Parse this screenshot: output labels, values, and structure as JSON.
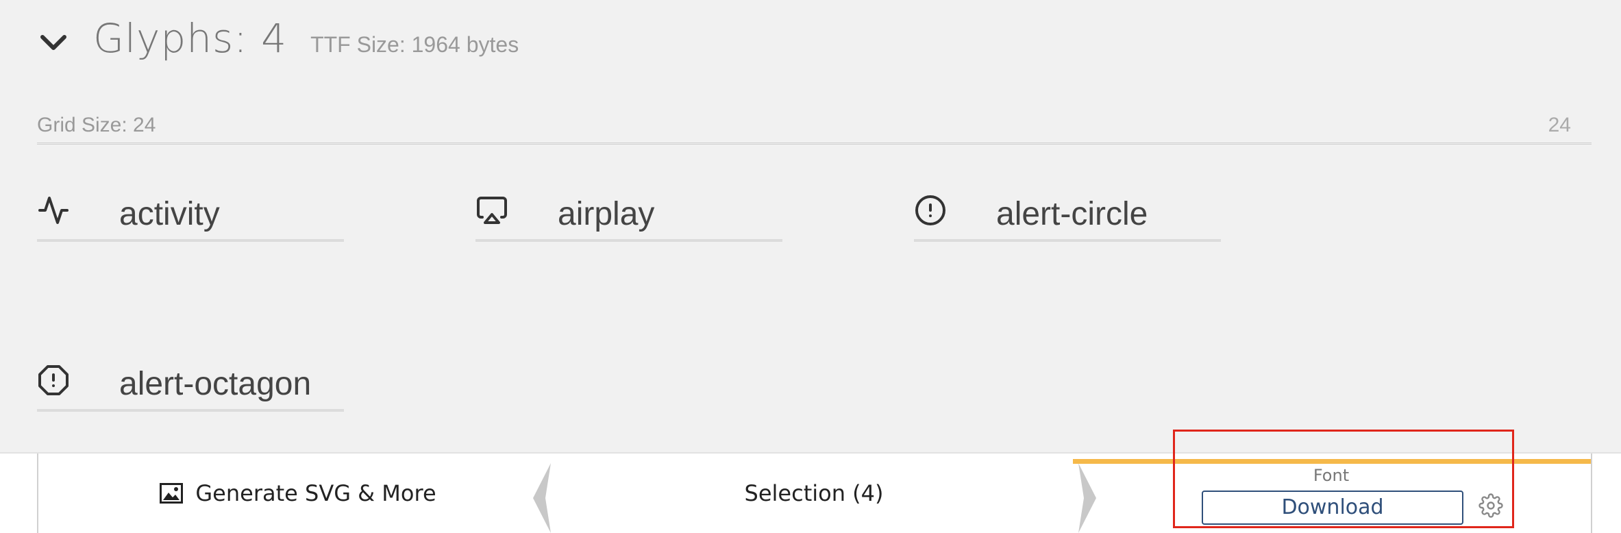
{
  "header": {
    "glyphs_title": "Glyphs: 4",
    "ttf_size": "TTF Size: 1964 bytes"
  },
  "grid": {
    "label": "Grid Size: 24",
    "value": "24"
  },
  "glyphs": [
    {
      "name": "activity",
      "icon": "activity-icon"
    },
    {
      "name": "airplay",
      "icon": "airplay-icon"
    },
    {
      "name": "alert-circle",
      "icon": "alert-circle-icon"
    },
    {
      "name": "alert-octagon",
      "icon": "alert-octagon-icon"
    }
  ],
  "bottom_bar": {
    "generate_label": "Generate SVG & More",
    "selection_label": "Selection (4)",
    "font_caption": "Font",
    "download_label": "Download"
  },
  "colors": {
    "accent": "#f5b94a",
    "button_blue": "#2f4f7a",
    "highlight_red": "#e0261b",
    "background": "#f1f1f1"
  }
}
